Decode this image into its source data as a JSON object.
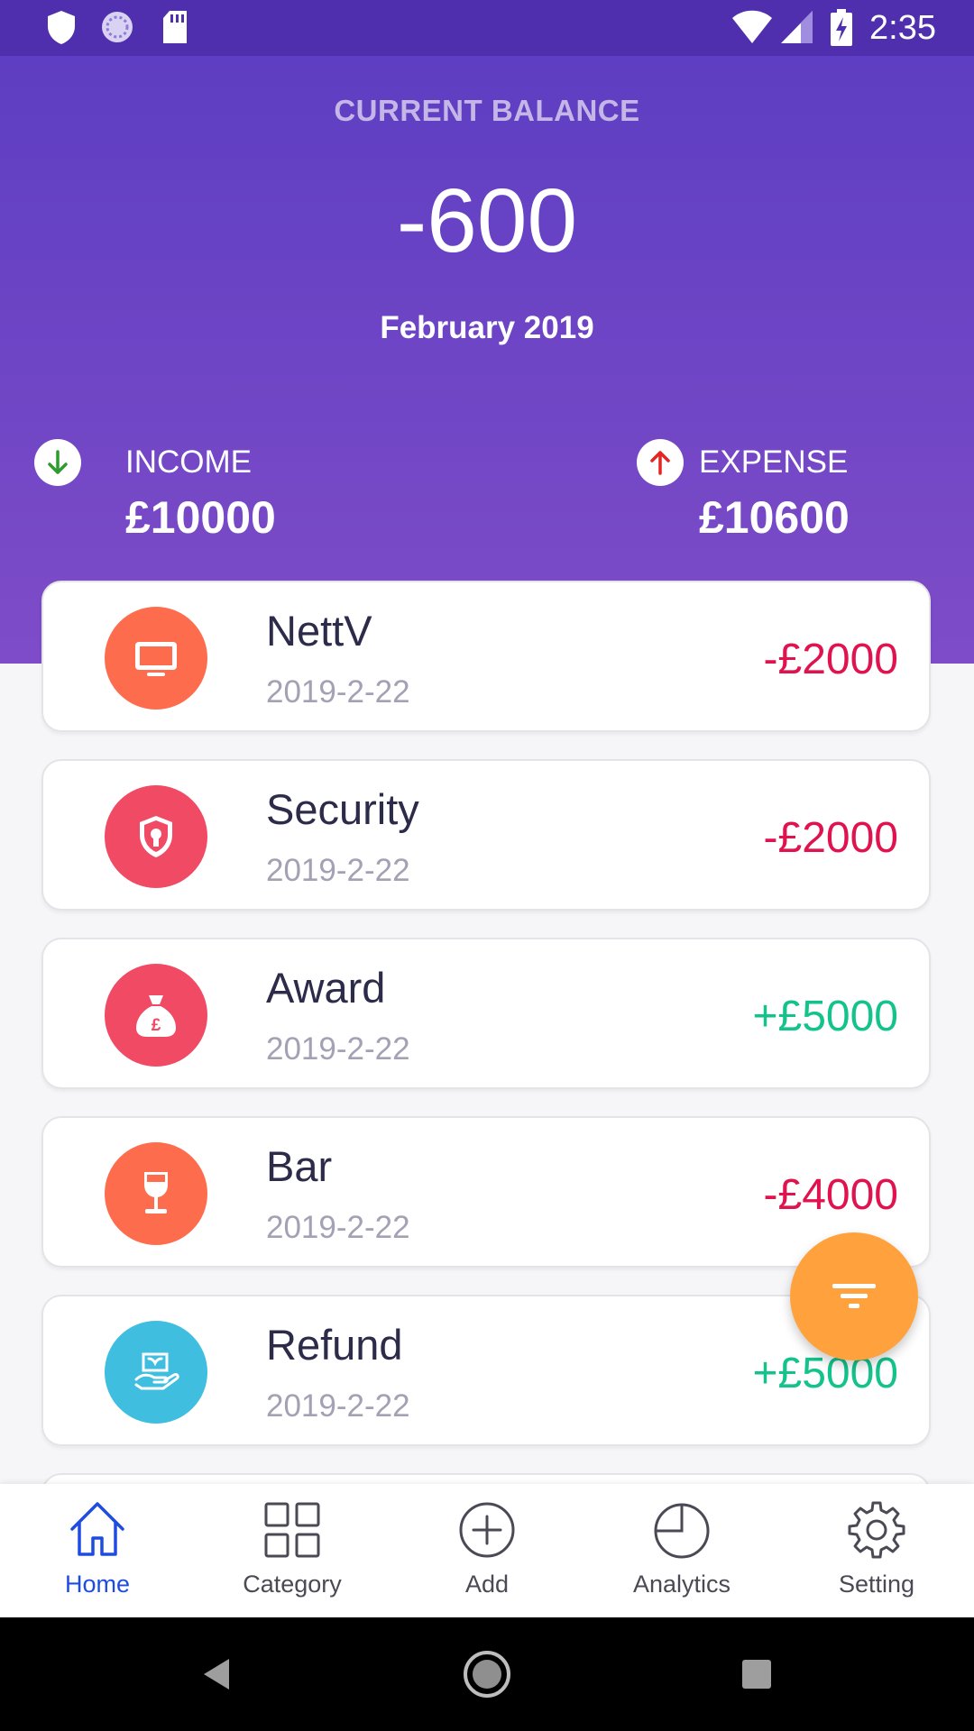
{
  "status_bar": {
    "time": "2:35",
    "icons": [
      "shield-icon",
      "sync-icon",
      "sd-card-icon",
      "wifi-icon",
      "signal-icon",
      "battery-charging-icon"
    ]
  },
  "header": {
    "label": "CURRENT BALANCE",
    "balance": "-600",
    "month": "February 2019",
    "income_label": "INCOME",
    "income_value": "£10000",
    "expense_label": "EXPENSE",
    "expense_value": "£10600"
  },
  "colors": {
    "header_gradient_top": "#5e3ec2",
    "header_gradient_bottom": "#7e4cc8",
    "expense_red": "#e0134f",
    "income_green": "#13c38b",
    "income_arrow": "#2e9b2e",
    "expense_arrow": "#e52424",
    "active_nav": "#1f4ce0",
    "inactive_nav": "#4a4a55",
    "fab": "#ffa23e"
  },
  "transactions": [
    {
      "name": "NettV",
      "date": "2019-2-22",
      "amount": "-£2000",
      "type": "expense",
      "icon": "tv-icon",
      "icon_color": "#fe6c4e"
    },
    {
      "name": "Security",
      "date": "2019-2-22",
      "amount": "-£2000",
      "type": "expense",
      "icon": "shield-lock-icon",
      "icon_color": "#f04a64"
    },
    {
      "name": "Award",
      "date": "2019-2-22",
      "amount": "+£5000",
      "type": "income",
      "icon": "money-bag-icon",
      "icon_color": "#f04a64"
    },
    {
      "name": "Bar",
      "date": "2019-2-22",
      "amount": "-£4000",
      "type": "expense",
      "icon": "wine-glass-icon",
      "icon_color": "#fe6c4e"
    },
    {
      "name": "Refund",
      "date": "2019-2-22",
      "amount": "+£5000",
      "type": "income",
      "icon": "hand-money-icon",
      "icon_color": "#3fbee0"
    }
  ],
  "fab": {
    "icon": "filter-icon"
  },
  "bottom_nav": [
    {
      "label": "Home",
      "icon": "home-icon",
      "active": true
    },
    {
      "label": "Category",
      "icon": "grid-icon",
      "active": false
    },
    {
      "label": "Add",
      "icon": "plus-circle-icon",
      "active": false
    },
    {
      "label": "Analytics",
      "icon": "pie-chart-icon",
      "active": false
    },
    {
      "label": "Setting",
      "icon": "gear-icon",
      "active": false
    }
  ],
  "system_nav": {
    "buttons": [
      "back-icon",
      "home-circle-icon",
      "recents-icon"
    ]
  }
}
